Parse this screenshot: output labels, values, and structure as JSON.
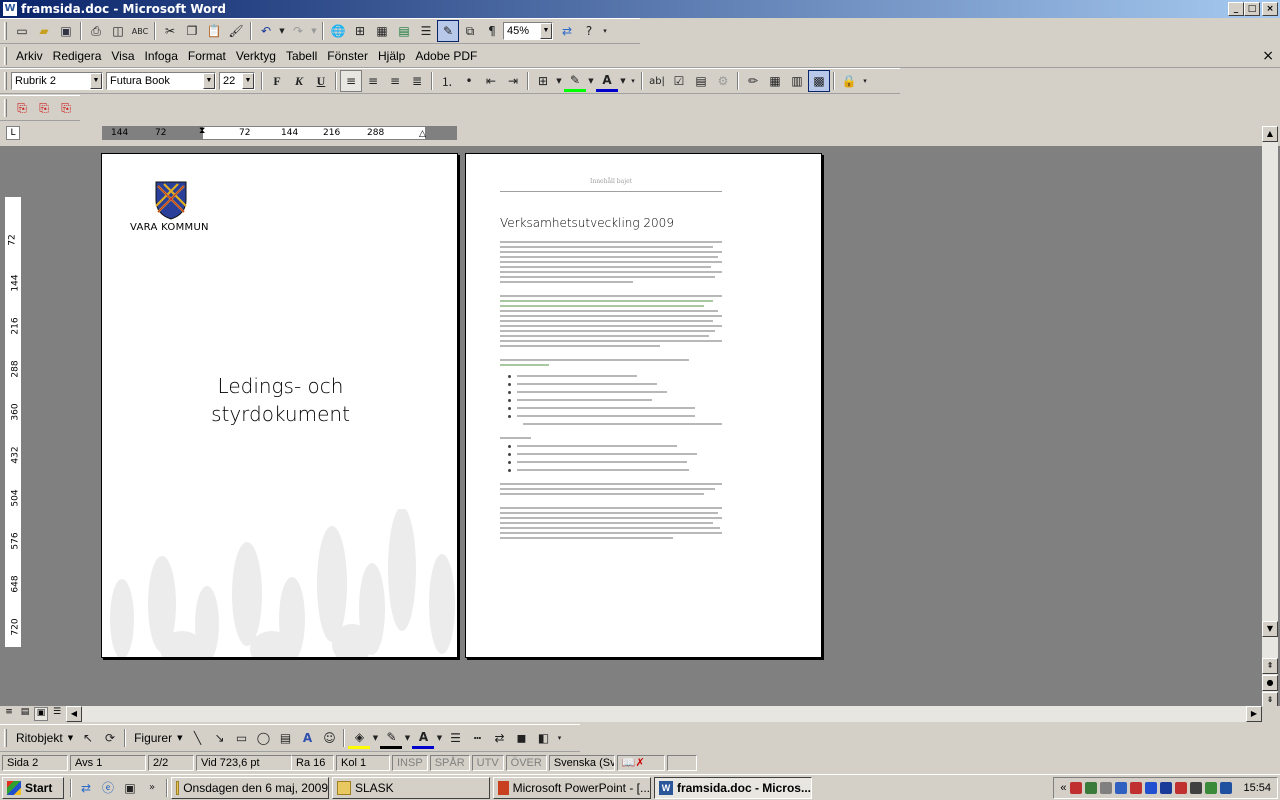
{
  "window": {
    "title": "framsida.doc - Microsoft Word",
    "minimize": "_",
    "maximize": "□",
    "close": "×"
  },
  "standard_toolbar": {
    "zoom": "45%"
  },
  "menus": [
    "Arkiv",
    "Redigera",
    "Visa",
    "Infoga",
    "Format",
    "Verktyg",
    "Tabell",
    "Fönster",
    "Hjälp",
    "Adobe PDF"
  ],
  "formatting": {
    "style": "Rubrik 2",
    "font": "Futura Book",
    "size": "22",
    "bold": "F",
    "italic": "K",
    "underline": "U"
  },
  "ruler": {
    "h_ticks": [
      "144",
      "72",
      "72",
      "144",
      "216",
      "288"
    ],
    "v_ticks": [
      "72",
      "144",
      "216",
      "288",
      "360",
      "432",
      "504",
      "576",
      "648",
      "720"
    ]
  },
  "page1": {
    "logo_text": "VARA KOMMUN",
    "title_line1": "Ledings- och",
    "title_line2": "styrdokument"
  },
  "page2": {
    "header": "Innehåll bajet",
    "heading": "Verksamhetsutveckling 2009"
  },
  "draw_toolbar": {
    "draw": "Ritobjekt",
    "shapes": "Figurer"
  },
  "status": {
    "page": "Sida  2",
    "section": "Avs  1",
    "pages": "2/2",
    "at": "Vid  723,6 pt",
    "line": "Ra  16",
    "col": "Kol  1",
    "rec": "INSP",
    "trk": "SPÅR",
    "ext": "UTV",
    "ovr": "ÖVER",
    "lang": "Svenska (Sv"
  },
  "taskbar": {
    "start": "Start",
    "tasks": [
      "Onsdagen den 6 maj, 2009",
      "SLASK",
      "Microsoft PowerPoint - [...",
      "framsida.doc - Micros..."
    ],
    "clock": "15:54"
  }
}
